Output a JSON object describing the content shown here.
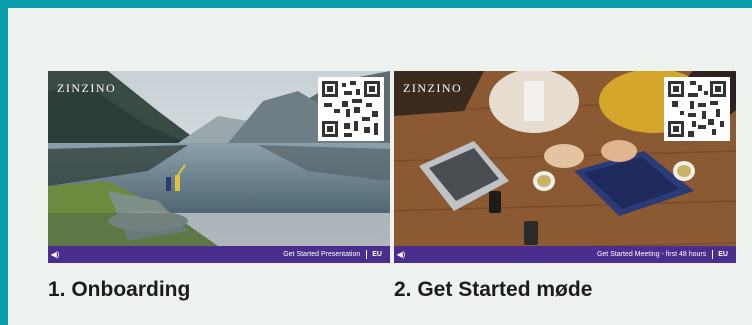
{
  "cards": [
    {
      "brand": "ZINZINO",
      "bar_label": "Get Started Presentation",
      "region": "EU",
      "caption": "1. Onboarding"
    },
    {
      "brand": "ZINZINO",
      "bar_label": "Get Started Meeting - first 48 hours",
      "region": "EU",
      "caption": "2. Get Started møde"
    }
  ],
  "icons": {
    "speaker": "speaker-icon",
    "qr": "qr-code-icon"
  },
  "colors": {
    "frame": "#0b9fae",
    "panel": "#eef2ef",
    "bar": "#4a2d8c"
  }
}
